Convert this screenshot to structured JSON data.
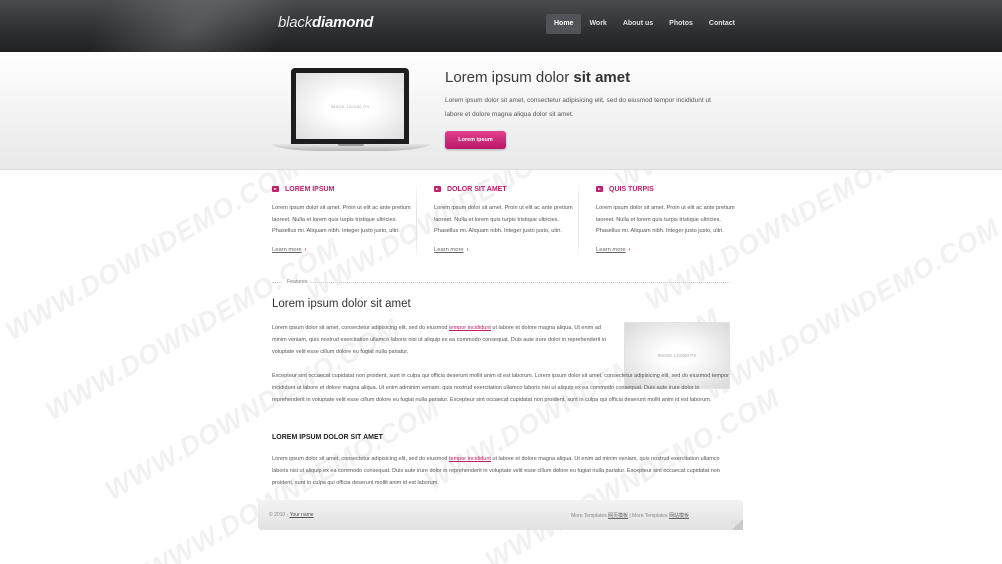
{
  "brand": {
    "logo_light": "black",
    "logo_bold": "diamond"
  },
  "nav": {
    "items": [
      "Home",
      "Work",
      "About us",
      "Photos",
      "Contact"
    ],
    "active_index": 0
  },
  "hero": {
    "title_light": "Lorem ipsum dolor ",
    "title_bold": "sit amet",
    "text": "Lorem ipsum dolor sit amet, consectetur adipisicing elit, sed do eiusmod tempor incididunt ut labore et dolore magna aliqua dolor sit amet.",
    "button_label": "Lorem ipsum",
    "image_placeholder": "IMAGE 120X80 PX"
  },
  "columns": [
    {
      "title": "LOREM IPSUM",
      "text": "Lorem ipsum dolor sit amet. Proin ut elit ac ante pretium laoreet. Nulla et lorem quis turpis tristique ultricies. Phasellus mi. Aliquam nibh. Integer justo justo, ultri.",
      "link": "Learn more"
    },
    {
      "title": "DOLOR SIT AMET",
      "text": "Lorem ipsum dolor sit amet. Proin ut elit ac ante pretium laoreet. Nulla et lorem quis turpis tristique ultricies. Phasellus mi. Aliquam nibh. Integer justo justo, ultri.",
      "link": "Learn more"
    },
    {
      "title": "QUIS TURPIS",
      "text": "Lorem ipsum dolor sit amet. Proin ut elit ac ante pretium laoreet. Nulla et lorem quis turpis tristique ultricies. Phasellus mi. Aliquam nibh. Integer justo justo, ultri.",
      "link": "Learn more"
    }
  ],
  "features_label": "Features",
  "main": {
    "title": "Lorem ipsum dolor sit amet",
    "p1_before": "Lorem ipsum dolor sit amet, consectetur adipisicing elit, sed do eiusmod ",
    "p1_link": "tempor incididunt",
    "p1_after": " ut labore et dolore magna aliqua. Ut enim ad minim veniam, quis nostrud exercitation ullamco laboris nisi ut aliquip ex ea commodo consequat. Duis aute irure dolor in reprehenderit in voluptate velit esse cillum dolore eu fugiat nulla pariatur.",
    "p2": "Excepteur sint occaecat cupidatat non proident, sunt in culpa qui officia deserunt mollit anim id est laborum. Lorem ipsum dolor sit amet, consectetur adipisicing elit, sed do eiusmod tempor incididunt ut labore et dolore magna aliqua. Ut enim adminim veniam, quis nostrud exercitation ullamco laboris nisi ut aliquip ex ea commodo consequat. Duis aute irure dolor in reprehenderit in voluptate velit esse cillum dolore eu fugiat nulla pariatur. Excepteur sint occaecat cupidatat non proident, sunt in culpa qui officia deserunt mollit anim id est laborum.",
    "image_placeholder": "IMAGE 120X80 PX",
    "subtitle": "LOREM IPSUM DOLOR SIT AMET",
    "p3_before": "Lorem ipsum dolor sit amet, consectetur adipisicing elit, sed do eiusmod ",
    "p3_link": "tempor incididunt",
    "p3_after": " ut labore et dolore magna aliqua. Ut enim ad minim veniam, quis nostrud exercitation ullamco laboris nisi ut aliquip ex ea commodo consequat. Duis aute irure dolor in reprehenderit in voluptate velit esse cillum dolore eu fugiat nulla pariatur. Excepteur sint occaecat cupidatat non proident, sunt in culpa qui officia deserunt mollit anim id est laborum."
  },
  "footer": {
    "copyright": "© 2010 - ",
    "your_name": "Your name",
    "more_prefix": "More Templates ",
    "link1": "网页模板",
    "separator": " | More Templates ",
    "link2": "网站模板"
  },
  "watermark": "WWW.DOWNDEMO.COM",
  "colors": {
    "accent": "#c1206b",
    "header_bg": "#2f3134",
    "button": "#d62c7e"
  }
}
